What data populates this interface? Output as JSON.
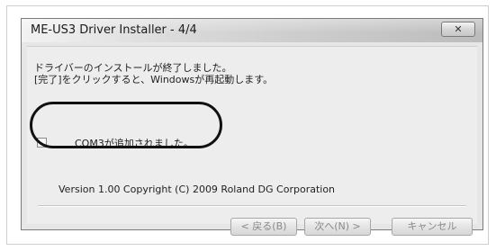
{
  "window": {
    "title": "ME-US3 Driver Installer - 4/4",
    "close_label": "✕"
  },
  "content": {
    "message_line1": "ドライバーのインストールが終了しました。",
    "message_line2": "[完了]をクリックすると、Windowsが再起動します。",
    "checkbox_label": "COM3が追加されました。",
    "checkbox_checked": false,
    "version_text": "Version 1.00  Copyright (C) 2009 Roland DG Corporation"
  },
  "buttons": {
    "back_label": "< 戻る(B)",
    "next_label": "次へ(N) >",
    "cancel_label": "キャンセル"
  }
}
